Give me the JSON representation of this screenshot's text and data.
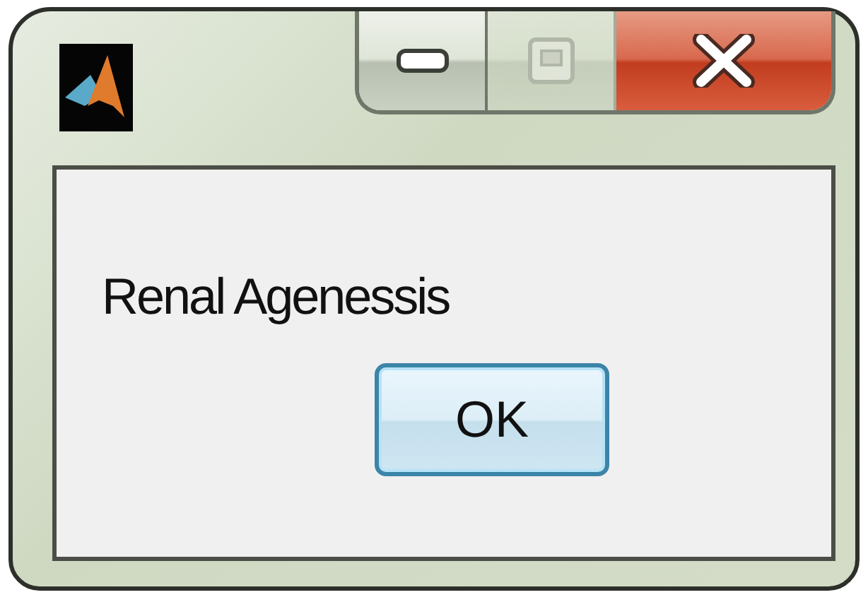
{
  "caption_buttons": [
    {
      "kind": "minimize",
      "disabled": false
    },
    {
      "kind": "maximize",
      "disabled": true
    },
    {
      "kind": "close",
      "disabled": false
    }
  ],
  "message": "Renal Agenessis",
  "buttons": [
    {
      "label": "OK",
      "default": true
    }
  ]
}
